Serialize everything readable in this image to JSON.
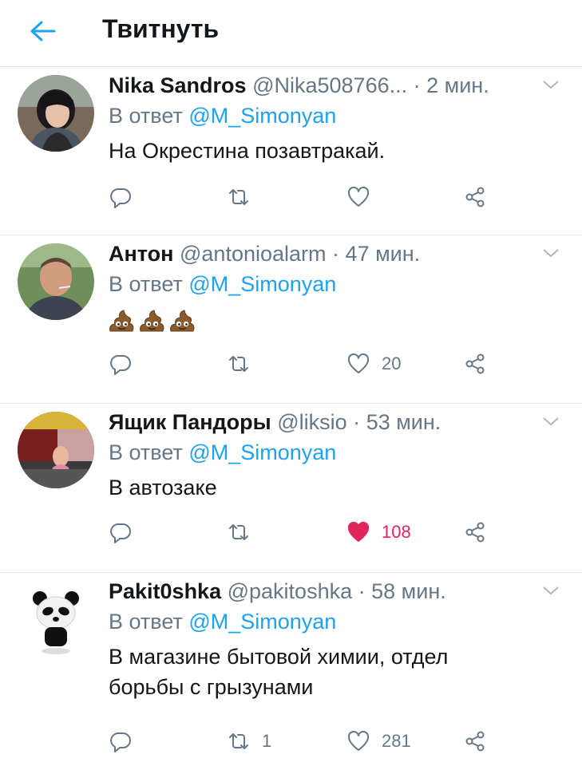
{
  "header": {
    "title": "Твитнуть"
  },
  "tweets": [
    {
      "name": "Nika Sandros",
      "handle": "@Nika508766...",
      "separator": "·",
      "time": "2 мин.",
      "reply_prefix": "В ответ",
      "reply_to": "@M_Simonyan",
      "text": "На Окрестина позавтракай.",
      "retweets": "",
      "likes": "",
      "liked": false
    },
    {
      "name": "Антон",
      "handle": "@antonioalarm",
      "separator": "·",
      "time": "47 мин.",
      "reply_prefix": "В ответ",
      "reply_to": "@M_Simonyan",
      "text": "💩💩💩",
      "emoji_count": 3,
      "emoji": "pile-of-poo",
      "retweets": "",
      "likes": "20",
      "liked": false
    },
    {
      "name": "Ящик Пандоры",
      "handle": "@liksio",
      "separator": "·",
      "time": "53 мин.",
      "reply_prefix": "В ответ",
      "reply_to": "@M_Simonyan",
      "text": "В автозаке",
      "retweets": "",
      "likes": "108",
      "liked": true
    },
    {
      "name": "Pakit0shka",
      "handle": "@pakitoshka",
      "separator": "·",
      "time": "58 мин.",
      "reply_prefix": "В ответ",
      "reply_to": "@M_Simonyan",
      "text": "В магазине бытовой химии, отдел борьбы с грызунами",
      "retweets": "1",
      "likes": "281",
      "liked": false
    }
  ],
  "colors": {
    "accent": "#1da1f2",
    "like": "#e0245e",
    "secondary": "#657786",
    "divider": "#e1e8ed"
  },
  "icons": [
    "arrow-left-icon",
    "chevron-down-icon",
    "reply-icon",
    "retweet-icon",
    "heart-icon",
    "share-icon"
  ]
}
